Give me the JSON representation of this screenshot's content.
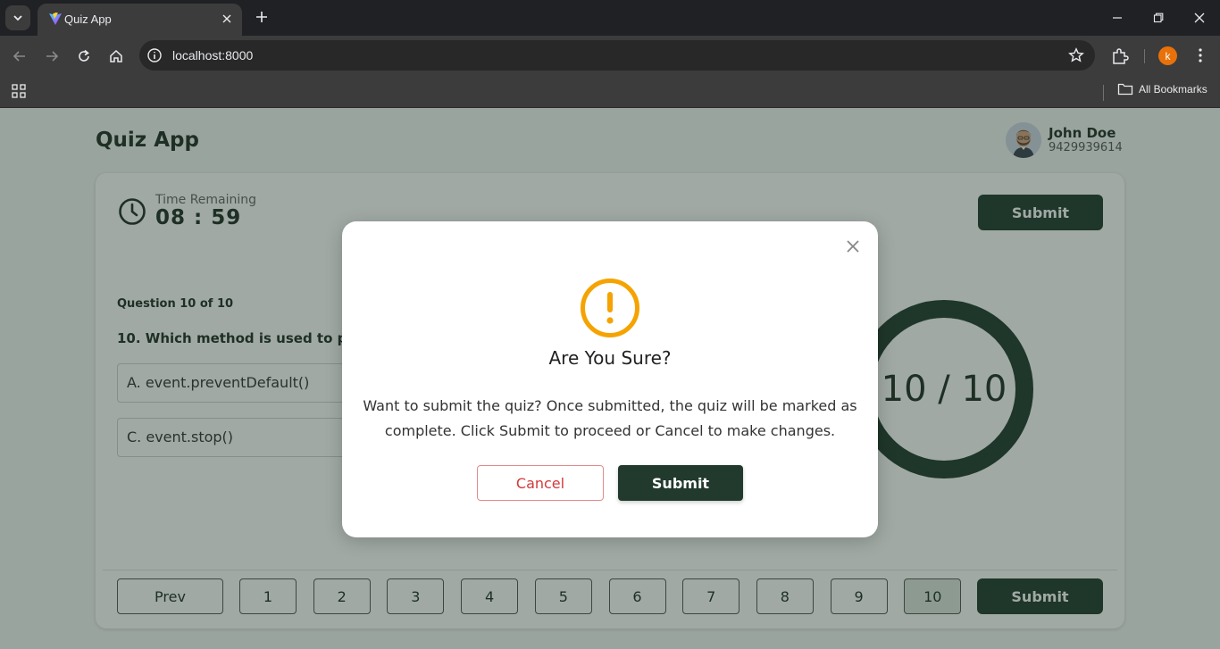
{
  "browser": {
    "tab_title": "Quiz App",
    "url": "localhost:8000",
    "profile_initial": "k",
    "bookmarks_label": "All Bookmarks"
  },
  "app": {
    "title": "Quiz App",
    "user": {
      "name": "John Doe",
      "phone": "9429939614"
    }
  },
  "timer": {
    "label": "Time Remaining",
    "value": "08 : 59"
  },
  "header_submit": "Submit",
  "question": {
    "count": "Question 10 of 10",
    "text": "10. Which method is used to pre",
    "options": [
      "A. event.preventDefault()",
      "C. event.stop()"
    ]
  },
  "progress": {
    "text": "10 / 10",
    "answered": 10,
    "total": 10
  },
  "pagination": {
    "prev": "Prev",
    "pages": [
      "1",
      "2",
      "3",
      "4",
      "5",
      "6",
      "7",
      "8",
      "9",
      "10"
    ],
    "active_page": "10",
    "submit": "Submit"
  },
  "modal": {
    "title": "Are You Sure?",
    "body": "Want to submit the quiz? Once submitted, the quiz will be marked as complete. Click Submit to proceed or Cancel to make changes.",
    "cancel": "Cancel",
    "submit": "Submit",
    "warning_icon": "exclamation-circle-icon"
  },
  "colors": {
    "accent": "#223a2e",
    "warning": "#f5a300",
    "danger": "#d23a3a"
  }
}
